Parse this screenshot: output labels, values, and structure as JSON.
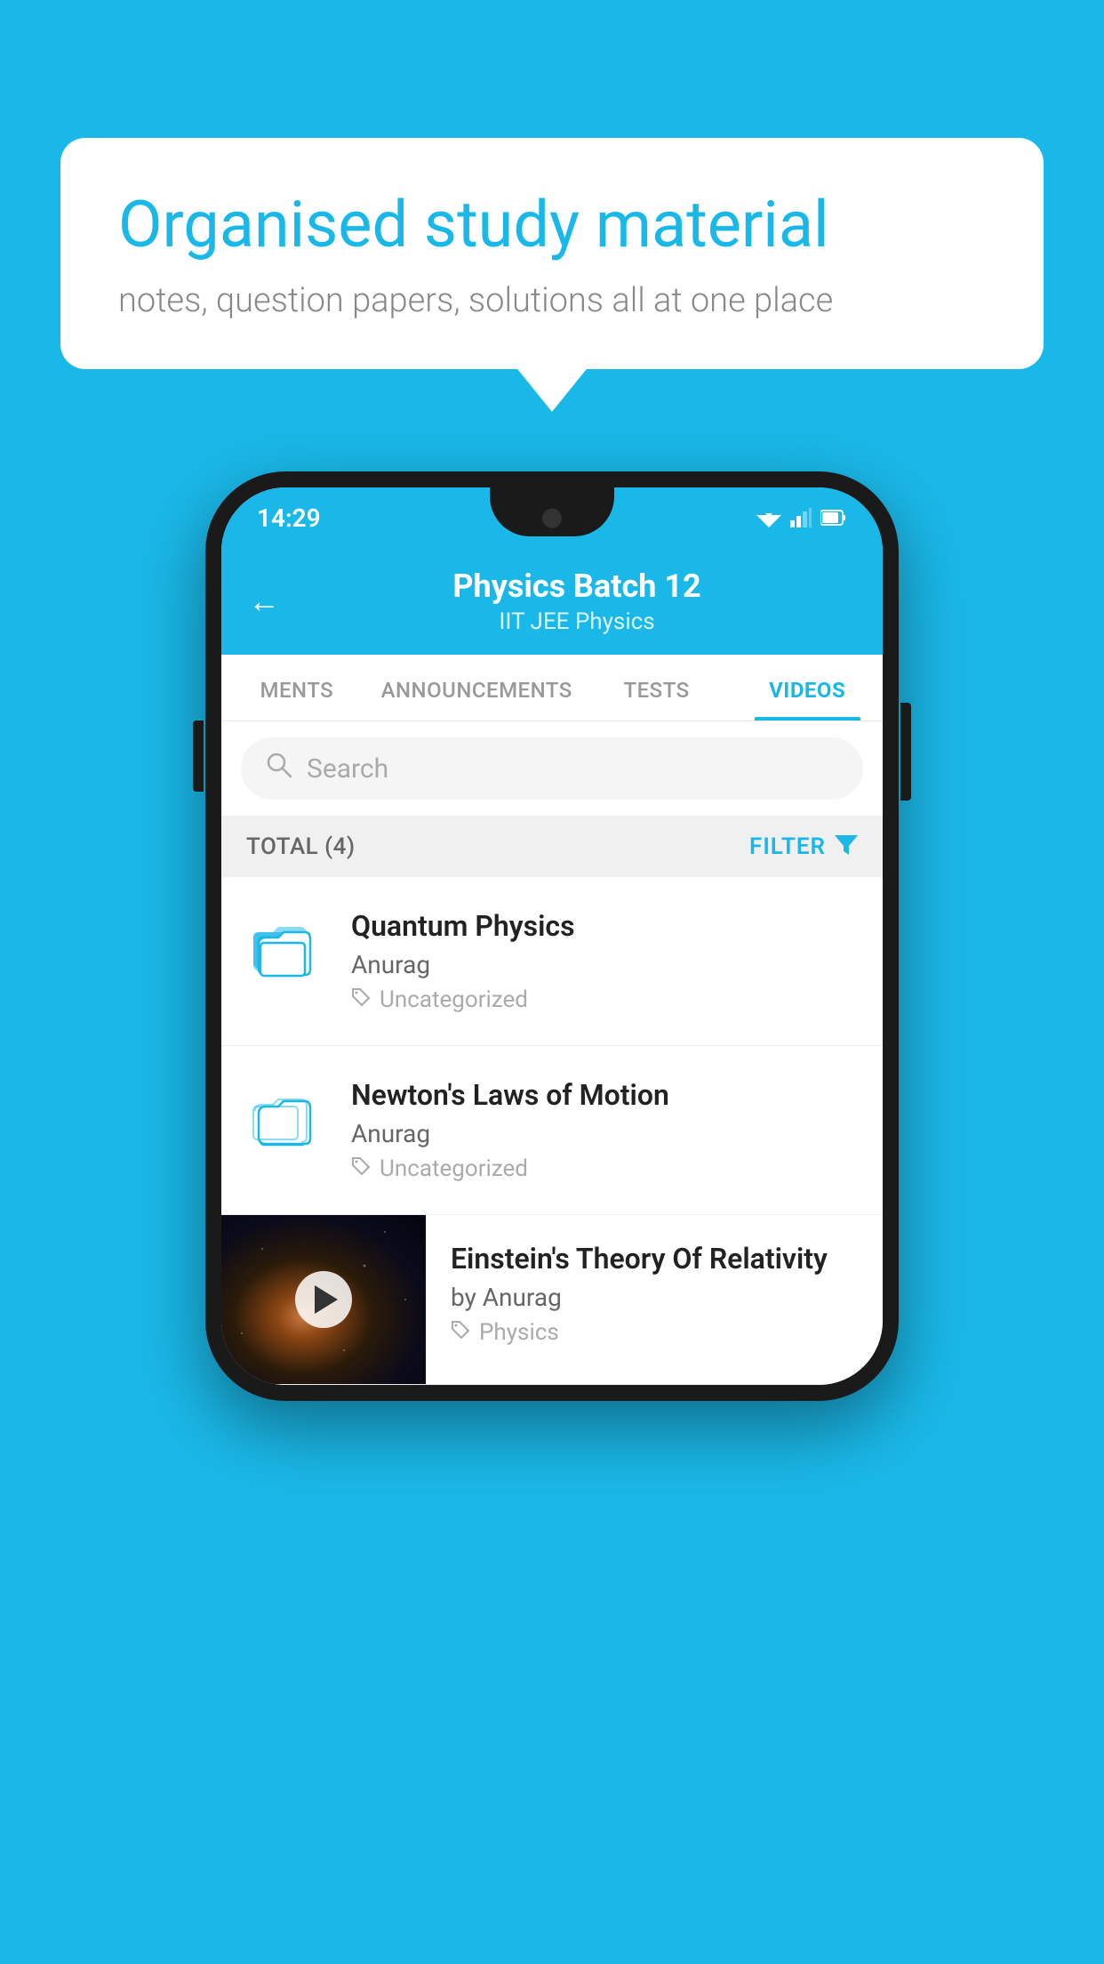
{
  "background": {
    "color": "#1ab8e8"
  },
  "speech_bubble": {
    "title": "Organised study material",
    "subtitle": "notes, question papers, solutions all at one place"
  },
  "phone": {
    "status_bar": {
      "time": "14:29"
    },
    "app_header": {
      "title": "Physics Batch 12",
      "subtitle": "IIT JEE   Physics",
      "back_label": "←"
    },
    "tabs": [
      {
        "label": "MENTS",
        "active": false
      },
      {
        "label": "ANNOUNCEMENTS",
        "active": false
      },
      {
        "label": "TESTS",
        "active": false
      },
      {
        "label": "VIDEOS",
        "active": true
      }
    ],
    "search": {
      "placeholder": "Search"
    },
    "filter_bar": {
      "total_label": "TOTAL (4)",
      "filter_label": "FILTER"
    },
    "videos": [
      {
        "id": "quantum",
        "title": "Quantum Physics",
        "author": "Anurag",
        "tag": "Uncategorized",
        "has_thumbnail": false
      },
      {
        "id": "newton",
        "title": "Newton's Laws of Motion",
        "author": "Anurag",
        "tag": "Uncategorized",
        "has_thumbnail": false
      },
      {
        "id": "einstein",
        "title": "Einstein's Theory Of Relativity",
        "author": "by Anurag",
        "tag": "Physics",
        "has_thumbnail": true
      }
    ]
  }
}
